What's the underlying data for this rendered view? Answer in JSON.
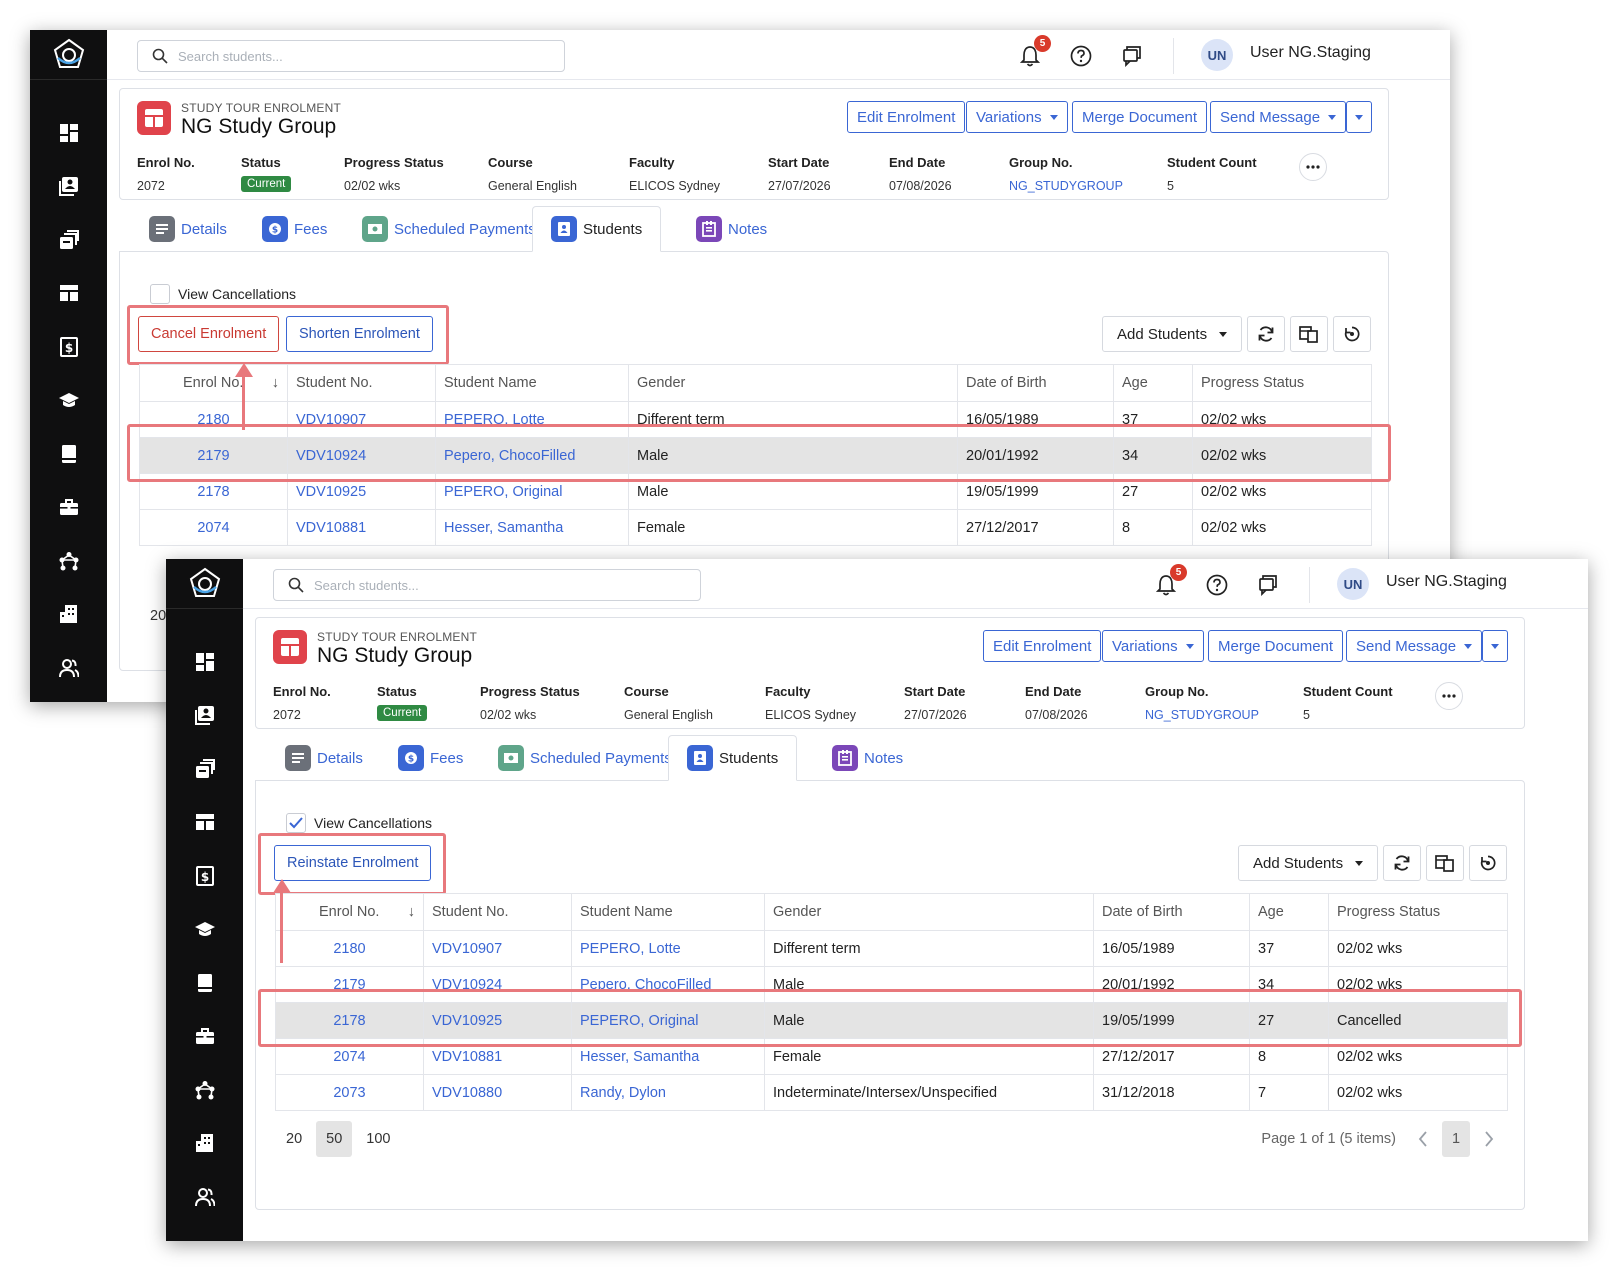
{
  "shared": {
    "search_placeholder": "Search students...",
    "notification_count": "5",
    "user_initials": "UN",
    "user_name": "User NG.Staging",
    "enrolment_type": "STUDY TOUR ENROLMENT",
    "enrolment_name": "NG Study Group",
    "header_buttons": {
      "edit": "Edit Enrolment",
      "variations": "Variations",
      "merge": "Merge Document",
      "send": "Send Message"
    },
    "fields": {
      "enrol_no_label": "Enrol No.",
      "enrol_no": "2072",
      "status_label": "Status",
      "status": "Current",
      "progress_label": "Progress Status",
      "progress": "02/02 wks",
      "course_label": "Course",
      "course": "General English",
      "faculty_label": "Faculty",
      "faculty": "ELICOS Sydney",
      "start_label": "Start Date",
      "start": "27/07/2026",
      "end_label": "End Date",
      "end": "07/08/2026",
      "group_label": "Group No.",
      "group": "NG_STUDYGROUP",
      "count_label": "Student Count",
      "count": "5"
    },
    "tabs": [
      "Details",
      "Fees",
      "Scheduled Payments",
      "Students",
      "Notes"
    ],
    "view_cancellations": "View Cancellations",
    "add_students": "Add Students",
    "columns": [
      "Enrol No.",
      "Student No.",
      "Student Name",
      "Gender",
      "Date of Birth",
      "Age",
      "Progress Status"
    ],
    "colors": {
      "accent": "#3a66d4",
      "danger": "#c93a33",
      "status_green": "#2f8a43",
      "highlight": "#e8787c",
      "sidebar": "#0f0f10"
    },
    "sidebar_icons": [
      "dashboard-icon",
      "student-card-icon",
      "enrolments-icon",
      "layout-icon",
      "fees-icon",
      "graduation-icon",
      "book-icon",
      "briefcase-icon",
      "network-icon",
      "building-icon",
      "users-icon"
    ]
  },
  "screen_a": {
    "cancel_button": "Cancel Enrolment",
    "shorten_button": "Shorten Enrolment",
    "view_cancellations_checked": false,
    "rows": [
      [
        "2180",
        "VDV10907",
        "PEPERO, Lotte",
        "Different term",
        "16/05/1989",
        "37",
        "02/02 wks"
      ],
      [
        "2179",
        "VDV10924",
        "Pepero, ChocoFilled",
        "Male",
        "20/01/1992",
        "34",
        "02/02 wks"
      ],
      [
        "2178",
        "VDV10925",
        "PEPERO, Original",
        "Male",
        "19/05/1999",
        "27",
        "02/02 wks"
      ],
      [
        "2074",
        "VDV10881",
        "Hesser, Samantha",
        "Female",
        "27/12/2017",
        "8",
        "02/02 wks"
      ]
    ],
    "selected_row": 1,
    "page_size_partial": "20"
  },
  "screen_b": {
    "reinstate_button": "Reinstate Enrolment",
    "view_cancellations_checked": true,
    "rows": [
      [
        "2180",
        "VDV10907",
        "PEPERO, Lotte",
        "Different term",
        "16/05/1989",
        "37",
        "02/02 wks"
      ],
      [
        "2179",
        "VDV10924",
        "Pepero, ChocoFilled",
        "Male",
        "20/01/1992",
        "34",
        "02/02 wks"
      ],
      [
        "2178",
        "VDV10925",
        "PEPERO, Original",
        "Male",
        "19/05/1999",
        "27",
        "Cancelled"
      ],
      [
        "2074",
        "VDV10881",
        "Hesser, Samantha",
        "Female",
        "27/12/2017",
        "8",
        "02/02 wks"
      ],
      [
        "2073",
        "VDV10880",
        "Randy, Dylon",
        "Indeterminate/Intersex/Unspecified",
        "31/12/2018",
        "7",
        "02/02 wks"
      ]
    ],
    "selected_row": 2,
    "page_sizes": [
      "20",
      "50",
      "100"
    ],
    "current_page_size": "50",
    "page_info": "Page 1 of 1 (5 items)",
    "current_page": "1"
  }
}
